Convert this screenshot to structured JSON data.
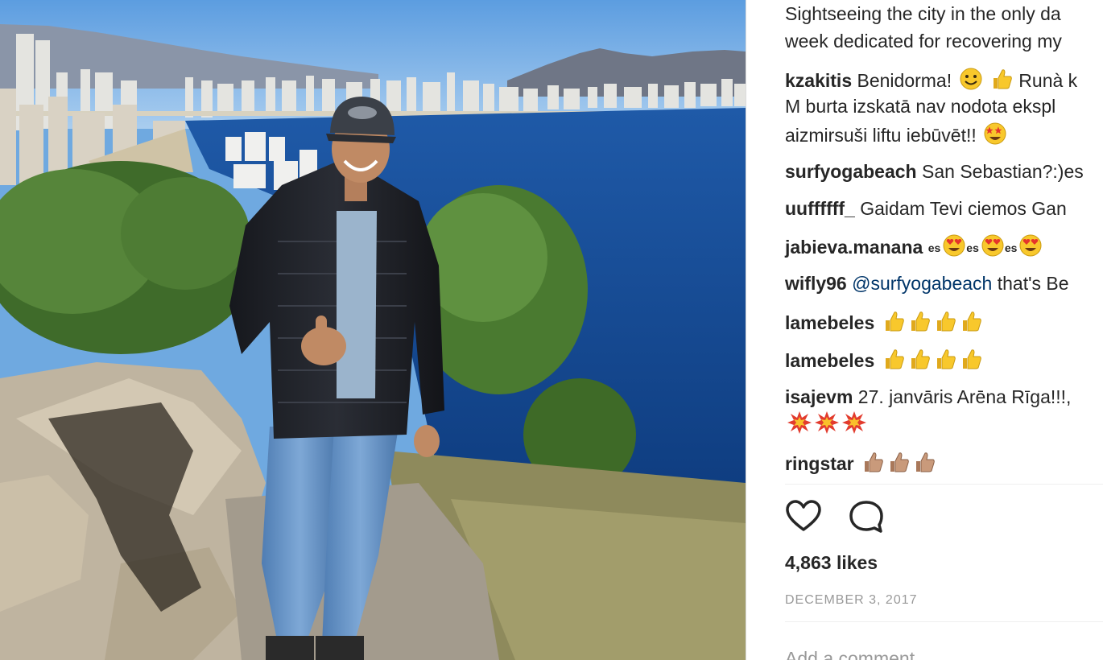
{
  "caption": {
    "line1": "Sightseeing the city in the only da",
    "line2": "week dedicated for recovering my"
  },
  "comments": [
    {
      "user": "kzakitis",
      "text": "Benidorma!",
      "emoji": [
        "smiley-emoji",
        "thumbs-up-emoji"
      ],
      "text_after": "Runà k"
    },
    {
      "user": "",
      "text": "M burta izskatā nav nodota ekspl"
    },
    {
      "user": "",
      "text": "aizmirsuši liftu iebūvēt!!",
      "emoji_after": [
        "star-struck-emoji"
      ]
    },
    {
      "user": "surfyogabeach",
      "text": "San Sebastian?:)es"
    },
    {
      "user": "uuffffff_",
      "text": "Gaidam Tevi ciemos Gan"
    },
    {
      "user": "jabieva.manana",
      "prefix": "es",
      "emoji": [
        "heart-eyes-emoji",
        "heart-eyes-emoji",
        "heart-eyes-emoji"
      ]
    },
    {
      "user": "wifly96",
      "mention": "@surfyogabeach",
      "text": "that's Be"
    },
    {
      "user": "lamebeles",
      "emoji": [
        "thumbs-up-emoji",
        "thumbs-up-emoji",
        "thumbs-up-emoji",
        "thumbs-up-emoji"
      ]
    },
    {
      "user": "lamebeles",
      "emoji": [
        "thumbs-up-emoji",
        "thumbs-up-emoji",
        "thumbs-up-emoji",
        "thumbs-up-emoji"
      ]
    },
    {
      "user": "isajevm",
      "text": "27. janvāris Arēna Rīga!!!,",
      "emoji_line2": [
        "collision-emoji",
        "collision-emoji",
        "collision-emoji"
      ]
    },
    {
      "user": "ringstar",
      "emoji": [
        "thumbs-up-tone-emoji",
        "thumbs-up-tone-emoji",
        "thumbs-up-tone-emoji"
      ]
    }
  ],
  "actions": {
    "like_icon": "heart-icon",
    "comment_icon": "comment-bubble-icon"
  },
  "likes_label": "4,863 likes",
  "date_label": "DECEMBER 3, 2017",
  "add_comment_placeholder": "Add a comment...",
  "colors": {
    "text": "#262626",
    "mention": "#003569",
    "muted": "#999999",
    "divider": "#efefef"
  }
}
